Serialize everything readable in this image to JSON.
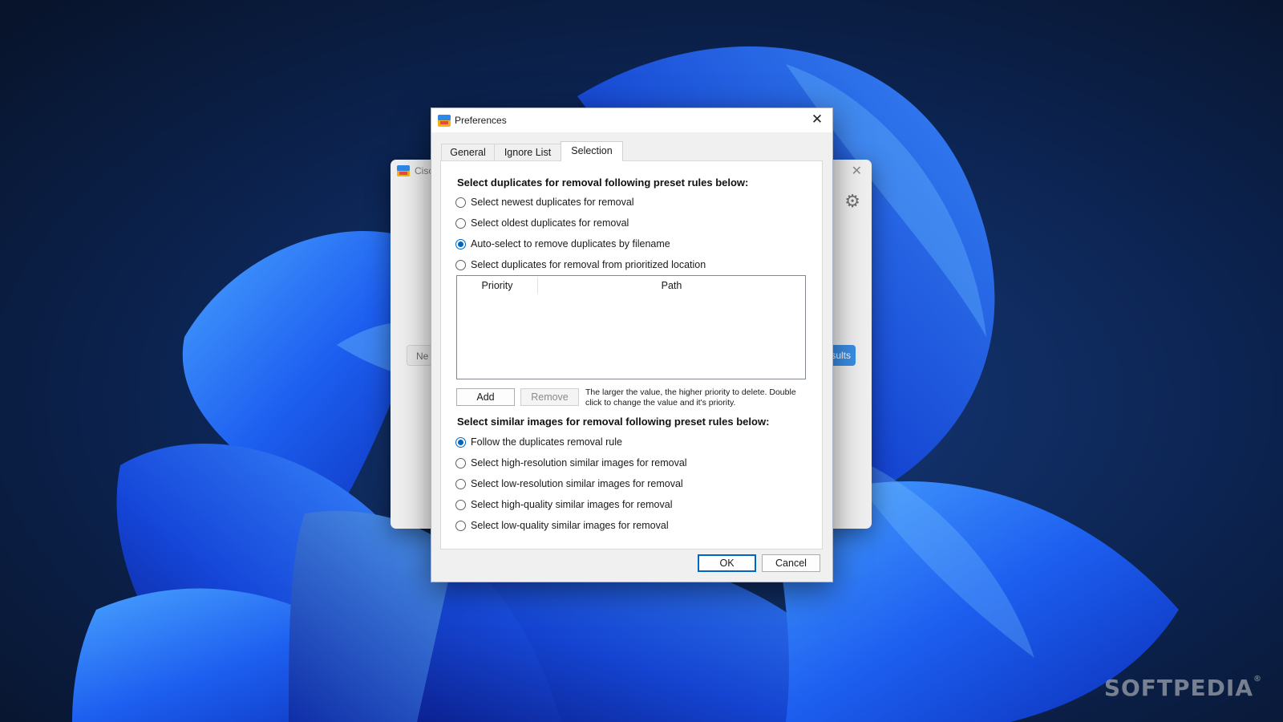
{
  "background_window": {
    "title_partial": "Cisc",
    "new_button_partial": "Ne",
    "results_button_partial": "sults",
    "icons": [
      "app-icon",
      "close-icon",
      "gear-icon"
    ]
  },
  "dialog": {
    "title": "Preferences",
    "close_glyph": "✕",
    "tabs": [
      {
        "label": "General",
        "active": false
      },
      {
        "label": "Ignore List",
        "active": false
      },
      {
        "label": "Selection",
        "active": true
      }
    ],
    "duplicates": {
      "heading": "Select duplicates for removal following preset rules below:",
      "options": [
        {
          "label": "Select newest duplicates for removal",
          "checked": false
        },
        {
          "label": "Select oldest duplicates for removal",
          "checked": false
        },
        {
          "label": "Auto-select to remove duplicates by filename",
          "checked": true
        },
        {
          "label": "Select duplicates for removal from prioritized location",
          "checked": false
        }
      ],
      "table": {
        "columns": [
          "Priority",
          "Path"
        ],
        "rows": []
      },
      "add_label": "Add",
      "remove_label": "Remove",
      "hint": "The larger the value, the higher priority to delete. Double click to change the value and it's priority."
    },
    "similar": {
      "heading": "Select similar images for removal following preset rules below:",
      "options": [
        {
          "label": "Follow the duplicates removal rule",
          "checked": true
        },
        {
          "label": "Select high-resolution similar images for removal",
          "checked": false
        },
        {
          "label": "Select low-resolution similar images for removal",
          "checked": false
        },
        {
          "label": "Select high-quality similar images for removal",
          "checked": false
        },
        {
          "label": "Select low-quality similar images for removal",
          "checked": false
        }
      ]
    },
    "ok_label": "OK",
    "cancel_label": "Cancel"
  },
  "watermark": "SOFTPEDIA",
  "watermark_mark": "®",
  "colors": {
    "accent": "#0067c0",
    "wallpaper_dark": "#0a1730",
    "wallpaper_blue": "#1f6cf5"
  }
}
